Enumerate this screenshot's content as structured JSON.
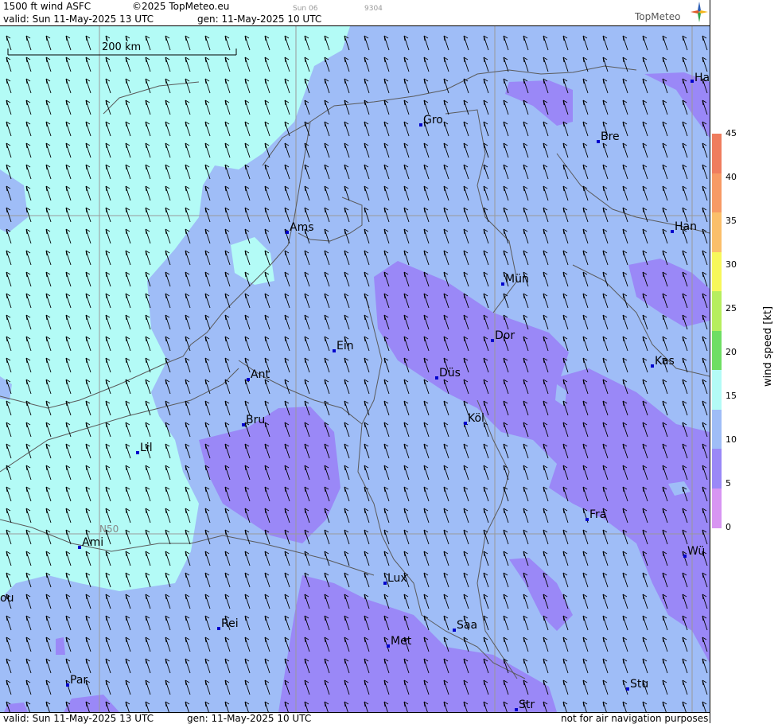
{
  "header": {
    "product": "1500 ft wind ASFC",
    "copyright": "©2025 TopMeteo.eu",
    "small_day": "Sun 06",
    "small_code": "9304",
    "valid": "valid:  Sun  11-May-2025  13 UTC",
    "gen": "gen: 11-May-2025 10 UTC",
    "brand": "TopMeteo"
  },
  "footer": {
    "valid": "valid:  Sun  11-May-2025  13 UTC",
    "gen": "gen: 11-May-2025 10 UTC",
    "disclaimer": "not for air navigation purposes"
  },
  "map": {
    "scale_label": "200 km",
    "lat_label": "N50",
    "cities": [
      "Ha",
      "Gro",
      "Bre",
      "Ams",
      "Han",
      "Mün",
      "Dor",
      "Ein",
      "Kas",
      "Düs",
      "Ant",
      "Köl",
      "Bru",
      "Lil",
      "Fra",
      "Ami",
      "Wü",
      "Lux",
      "ou",
      "Rei",
      "Saa",
      "Met",
      "Stu",
      "Par",
      "Str"
    ],
    "wind_direction": "south-southeast",
    "colors": {
      "lightcyan": "#b3fbf6",
      "lightblue": "#9fbdf7",
      "violet": "#9a88f7"
    }
  },
  "legend": {
    "unit_label": "wind speed  [kt]",
    "ticks": [
      "45",
      "40",
      "35",
      "30",
      "25",
      "20",
      "15",
      "10",
      "5",
      "0"
    ],
    "colors": [
      "#ef7d5e",
      "#f79a64",
      "#fbbf6a",
      "#f7f75a",
      "#b6ee5e",
      "#6ede63",
      "#b3fbf6",
      "#9fbdf7",
      "#9a88f7",
      "#d895f2"
    ]
  }
}
